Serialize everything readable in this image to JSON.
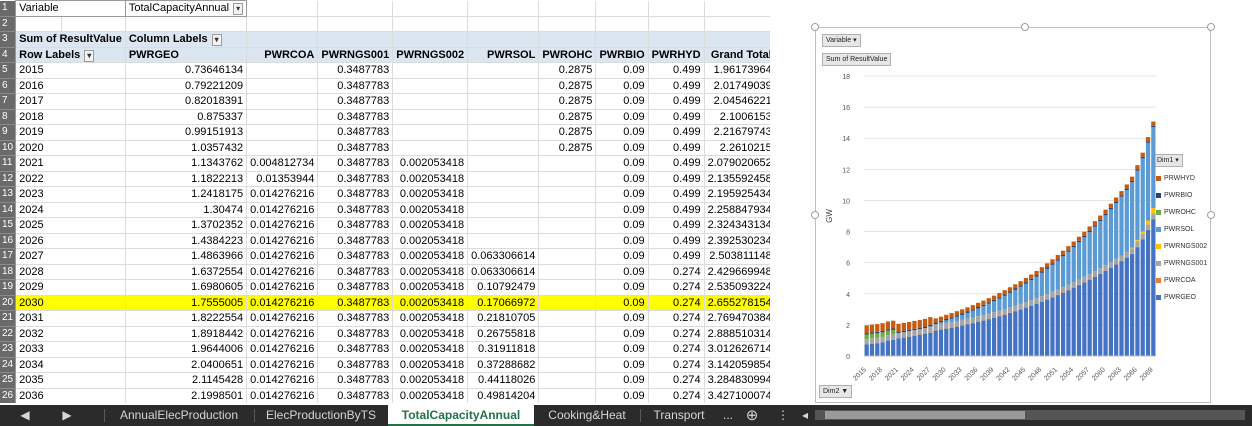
{
  "filter": {
    "label": "Variable",
    "value": "TotalCapacityAnnual"
  },
  "pivot": {
    "values_label": "Sum of ResultValue",
    "column_labels": "Column Labels",
    "row_labels": "Row Labels",
    "columns": [
      "PWRGEO",
      "PWRCOA",
      "PWRNGS001",
      "PWRNGS002",
      "PWRSOL",
      "PWROHC",
      "PWRBIO",
      "PWRHYD",
      "Grand Total"
    ],
    "rows": [
      {
        "n": "5",
        "year": "2015",
        "v": [
          "0.73646134",
          "",
          "0.3487783",
          "",
          "",
          "0.2875",
          "0.09",
          "0.499",
          "1.96173964"
        ]
      },
      {
        "n": "6",
        "year": "2016",
        "v": [
          "0.79221209",
          "",
          "0.3487783",
          "",
          "",
          "0.2875",
          "0.09",
          "0.499",
          "2.01749039"
        ]
      },
      {
        "n": "7",
        "year": "2017",
        "v": [
          "0.82018391",
          "",
          "0.3487783",
          "",
          "",
          "0.2875",
          "0.09",
          "0.499",
          "2.04546221"
        ]
      },
      {
        "n": "8",
        "year": "2018",
        "v": [
          "0.875337",
          "",
          "0.3487783",
          "",
          "",
          "0.2875",
          "0.09",
          "0.499",
          "2.1006153"
        ]
      },
      {
        "n": "9",
        "year": "2019",
        "v": [
          "0.99151913",
          "",
          "0.3487783",
          "",
          "",
          "0.2875",
          "0.09",
          "0.499",
          "2.21679743"
        ]
      },
      {
        "n": "10",
        "year": "2020",
        "v": [
          "1.0357432",
          "",
          "0.3487783",
          "",
          "",
          "0.2875",
          "0.09",
          "0.499",
          "2.2610215"
        ]
      },
      {
        "n": "11",
        "year": "2021",
        "v": [
          "1.1343762",
          "0.004812734",
          "0.3487783",
          "0.002053418",
          "",
          "",
          "0.09",
          "0.499",
          "2.079020652"
        ]
      },
      {
        "n": "12",
        "year": "2022",
        "v": [
          "1.1822213",
          "0.01353944",
          "0.3487783",
          "0.002053418",
          "",
          "",
          "0.09",
          "0.499",
          "2.135592458"
        ]
      },
      {
        "n": "13",
        "year": "2023",
        "v": [
          "1.2418175",
          "0.014276216",
          "0.3487783",
          "0.002053418",
          "",
          "",
          "0.09",
          "0.499",
          "2.195925434"
        ]
      },
      {
        "n": "14",
        "year": "2024",
        "v": [
          "1.30474",
          "0.014276216",
          "0.3487783",
          "0.002053418",
          "",
          "",
          "0.09",
          "0.499",
          "2.258847934"
        ]
      },
      {
        "n": "15",
        "year": "2025",
        "v": [
          "1.3702352",
          "0.014276216",
          "0.3487783",
          "0.002053418",
          "",
          "",
          "0.09",
          "0.499",
          "2.324343134"
        ]
      },
      {
        "n": "16",
        "year": "2026",
        "v": [
          "1.4384223",
          "0.014276216",
          "0.3487783",
          "0.002053418",
          "",
          "",
          "0.09",
          "0.499",
          "2.392530234"
        ]
      },
      {
        "n": "17",
        "year": "2027",
        "v": [
          "1.4863966",
          "0.014276216",
          "0.3487783",
          "0.002053418",
          "0.063306614",
          "",
          "0.09",
          "0.499",
          "2.503811148"
        ]
      },
      {
        "n": "18",
        "year": "2028",
        "v": [
          "1.6372554",
          "0.014276216",
          "0.3487783",
          "0.002053418",
          "0.063306614",
          "",
          "0.09",
          "0.274",
          "2.429669948"
        ]
      },
      {
        "n": "19",
        "year": "2029",
        "v": [
          "1.6980605",
          "0.014276216",
          "0.3487783",
          "0.002053418",
          "0.10792479",
          "",
          "0.09",
          "0.274",
          "2.535093224"
        ]
      },
      {
        "n": "20",
        "year": "2030",
        "v": [
          "1.7555005",
          "0.014276216",
          "0.3487783",
          "0.002053418",
          "0.17066972",
          "",
          "0.09",
          "0.274",
          "2.655278154"
        ],
        "highlight": true
      },
      {
        "n": "21",
        "year": "2031",
        "v": [
          "1.8222554",
          "0.014276216",
          "0.3487783",
          "0.002053418",
          "0.21810705",
          "",
          "0.09",
          "0.274",
          "2.769470384"
        ]
      },
      {
        "n": "22",
        "year": "2032",
        "v": [
          "1.8918442",
          "0.014276216",
          "0.3487783",
          "0.002053418",
          "0.26755818",
          "",
          "0.09",
          "0.274",
          "2.888510314"
        ]
      },
      {
        "n": "23",
        "year": "2033",
        "v": [
          "1.9644006",
          "0.014276216",
          "0.3487783",
          "0.002053418",
          "0.31911818",
          "",
          "0.09",
          "0.274",
          "3.012626714"
        ]
      },
      {
        "n": "24",
        "year": "2034",
        "v": [
          "2.0400651",
          "0.014276216",
          "0.3487783",
          "0.002053418",
          "0.37288682",
          "",
          "0.09",
          "0.274",
          "3.142059854"
        ]
      },
      {
        "n": "25",
        "year": "2035",
        "v": [
          "2.1145428",
          "0.014276216",
          "0.3487783",
          "0.002053418",
          "0.44118026",
          "",
          "0.09",
          "0.274",
          "3.284830994"
        ]
      },
      {
        "n": "26",
        "year": "2036",
        "v": [
          "2.1998501",
          "0.014276216",
          "0.3487783",
          "0.002053418",
          "0.49814204",
          "",
          "0.09",
          "0.274",
          "3.427100074"
        ]
      }
    ]
  },
  "chart": {
    "variable_btn": "Variable",
    "values_btn": "Sum of ResultValue",
    "dim2_btn": "Dim2 ▼",
    "dim1_btn": "Dim1",
    "colors": {
      "PRWHYD": "#c55a11",
      "PWRBIO": "#264478",
      "PWROHC": "#70ad47",
      "PWRSOL": "#5b9bd5",
      "PWRNGS002": "#ffc000",
      "PWRNGS001": "#a5a5a5",
      "PWRCOA": "#ed7d31",
      "PWRGEO": "#4472c4"
    }
  },
  "chart_data": {
    "type": "bar",
    "stacked": true,
    "ylabel": "GW",
    "ylim": [
      0,
      18
    ],
    "yticks": [
      0,
      2,
      4,
      6,
      8,
      10,
      12,
      14,
      16,
      18
    ],
    "xtick_labels": [
      "2015",
      "2018",
      "2021",
      "2024",
      "2027",
      "2030",
      "2033",
      "2036",
      "2039",
      "2042",
      "2045",
      "2048",
      "2051",
      "2054",
      "2057",
      "2060",
      "2063",
      "2066",
      "2069"
    ],
    "x_start": 2015,
    "x_end": 2070,
    "legend_order": [
      "PRWHYD",
      "PWRBIO",
      "PWROHC",
      "PWRSOL",
      "PWRNGS002",
      "PWRNGS001",
      "PWRCOA",
      "PWRGEO"
    ],
    "series": [
      {
        "name": "PWRGEO",
        "values": [
          0.74,
          0.79,
          0.82,
          0.88,
          0.99,
          1.04,
          1.13,
          1.18,
          1.24,
          1.3,
          1.37,
          1.44,
          1.49,
          1.64,
          1.7,
          1.76,
          1.82,
          1.89,
          1.96,
          2.04,
          2.11,
          2.2,
          2.28,
          2.37,
          2.46,
          2.56,
          2.66,
          2.77,
          2.88,
          2.99,
          3.11,
          3.23,
          3.36,
          3.49,
          3.63,
          3.77,
          3.92,
          4.07,
          4.23,
          4.39,
          4.56,
          4.73,
          4.91,
          5.09,
          5.28,
          5.48,
          5.68,
          5.89,
          6.1,
          6.33,
          6.56,
          7.0,
          7.5,
          8.1,
          8.8
        ]
      },
      {
        "name": "PWRCOA",
        "values": [
          0,
          0,
          0,
          0,
          0,
          0,
          0,
          0.01,
          0.01,
          0.01,
          0.01,
          0.01,
          0.01,
          0.01,
          0.01,
          0.01,
          0.01,
          0.01,
          0.01,
          0.01,
          0.01,
          0.01,
          0.01,
          0.01,
          0.01,
          0.01,
          0.01,
          0.01,
          0.01,
          0.01,
          0.01,
          0.01,
          0.01,
          0.01,
          0.01,
          0.01,
          0.01,
          0.01,
          0.01,
          0.01,
          0.01,
          0.01,
          0.01,
          0.01,
          0.01,
          0.01,
          0.01,
          0.01,
          0.01,
          0.01,
          0.01,
          0.01,
          0.01,
          0.01,
          0.01
        ]
      },
      {
        "name": "PWRNGS001",
        "values": [
          0.35,
          0.35,
          0.35,
          0.35,
          0.35,
          0.35,
          0.35,
          0.35,
          0.35,
          0.35,
          0.35,
          0.35,
          0.35,
          0.35,
          0.35,
          0.35,
          0.35,
          0.35,
          0.35,
          0.35,
          0.35,
          0.35,
          0.35,
          0.35,
          0.35,
          0.35,
          0.35,
          0.35,
          0.35,
          0.35,
          0.35,
          0.35,
          0.35,
          0.35,
          0.35,
          0.35,
          0.35,
          0.35,
          0.35,
          0.35,
          0.35,
          0.35,
          0.35,
          0.35,
          0.35,
          0.35,
          0.35,
          0.35,
          0.35,
          0.35,
          0.35,
          0.35,
          0.35,
          0.35,
          0.35
        ]
      },
      {
        "name": "PWRNGS002",
        "values": [
          0,
          0,
          0,
          0,
          0,
          0,
          0,
          0,
          0,
          0,
          0,
          0,
          0,
          0,
          0,
          0,
          0,
          0,
          0,
          0,
          0,
          0,
          0,
          0,
          0,
          0,
          0,
          0,
          0,
          0,
          0,
          0,
          0,
          0,
          0,
          0,
          0,
          0,
          0,
          0,
          0,
          0,
          0,
          0,
          0,
          0,
          0,
          0,
          0,
          0,
          0.05,
          0.1,
          0.15,
          0.25,
          0.35
        ]
      },
      {
        "name": "PWRSOL",
        "values": [
          0,
          0,
          0,
          0,
          0,
          0,
          0,
          0,
          0,
          0,
          0,
          0,
          0.06,
          0.06,
          0.11,
          0.17,
          0.22,
          0.27,
          0.32,
          0.37,
          0.44,
          0.5,
          0.56,
          0.63,
          0.7,
          0.77,
          0.85,
          0.93,
          1.01,
          1.1,
          1.19,
          1.29,
          1.39,
          1.5,
          1.61,
          1.73,
          1.85,
          1.98,
          2.11,
          2.25,
          2.39,
          2.54,
          2.7,
          2.86,
          3.03,
          3.21,
          3.39,
          3.58,
          3.78,
          3.98,
          4.2,
          4.45,
          4.7,
          5.0,
          5.2
        ]
      },
      {
        "name": "PWROHC",
        "values": [
          0.29,
          0.29,
          0.29,
          0.29,
          0.29,
          0.29,
          0,
          0,
          0,
          0,
          0,
          0,
          0,
          0,
          0,
          0,
          0,
          0,
          0,
          0,
          0,
          0,
          0,
          0,
          0,
          0,
          0,
          0,
          0,
          0,
          0,
          0,
          0,
          0,
          0,
          0,
          0,
          0,
          0,
          0,
          0,
          0,
          0,
          0,
          0,
          0,
          0,
          0,
          0,
          0,
          0,
          0,
          0,
          0,
          0
        ]
      },
      {
        "name": "PWRBIO",
        "values": [
          0.09,
          0.09,
          0.09,
          0.09,
          0.09,
          0.09,
          0.09,
          0.09,
          0.09,
          0.09,
          0.09,
          0.09,
          0.09,
          0.09,
          0.09,
          0.09,
          0.09,
          0.09,
          0.09,
          0.09,
          0.09,
          0.09,
          0.09,
          0.09,
          0.09,
          0.09,
          0.09,
          0.09,
          0.09,
          0.09,
          0.09,
          0.09,
          0.09,
          0.09,
          0.09,
          0.09,
          0.09,
          0.09,
          0.09,
          0.09,
          0.09,
          0.09,
          0.09,
          0.09,
          0.09,
          0.09,
          0.09,
          0.09,
          0.09,
          0.09,
          0.09,
          0.09,
          0.09,
          0.09,
          0.09
        ]
      },
      {
        "name": "PRWHYD",
        "values": [
          0.5,
          0.5,
          0.5,
          0.5,
          0.5,
          0.5,
          0.5,
          0.5,
          0.5,
          0.5,
          0.5,
          0.5,
          0.5,
          0.27,
          0.27,
          0.27,
          0.27,
          0.27,
          0.27,
          0.27,
          0.27,
          0.27,
          0.27,
          0.27,
          0.27,
          0.27,
          0.27,
          0.27,
          0.27,
          0.27,
          0.27,
          0.27,
          0.27,
          0.27,
          0.27,
          0.27,
          0.27,
          0.27,
          0.27,
          0.27,
          0.27,
          0.27,
          0.27,
          0.27,
          0.27,
          0.27,
          0.27,
          0.27,
          0.27,
          0.27,
          0.27,
          0.27,
          0.27,
          0.27,
          0.27
        ]
      }
    ]
  },
  "tabs": {
    "nav_prev": "◀",
    "nav_next": "▶",
    "items": [
      "AnnualElecProduction",
      "ElecProductionByTS",
      "TotalCapacityAnnual",
      "Cooking&Heat",
      "Transport"
    ],
    "more": "...",
    "add": "⊕",
    "menu": "⋮",
    "scroll_left": "◂"
  }
}
